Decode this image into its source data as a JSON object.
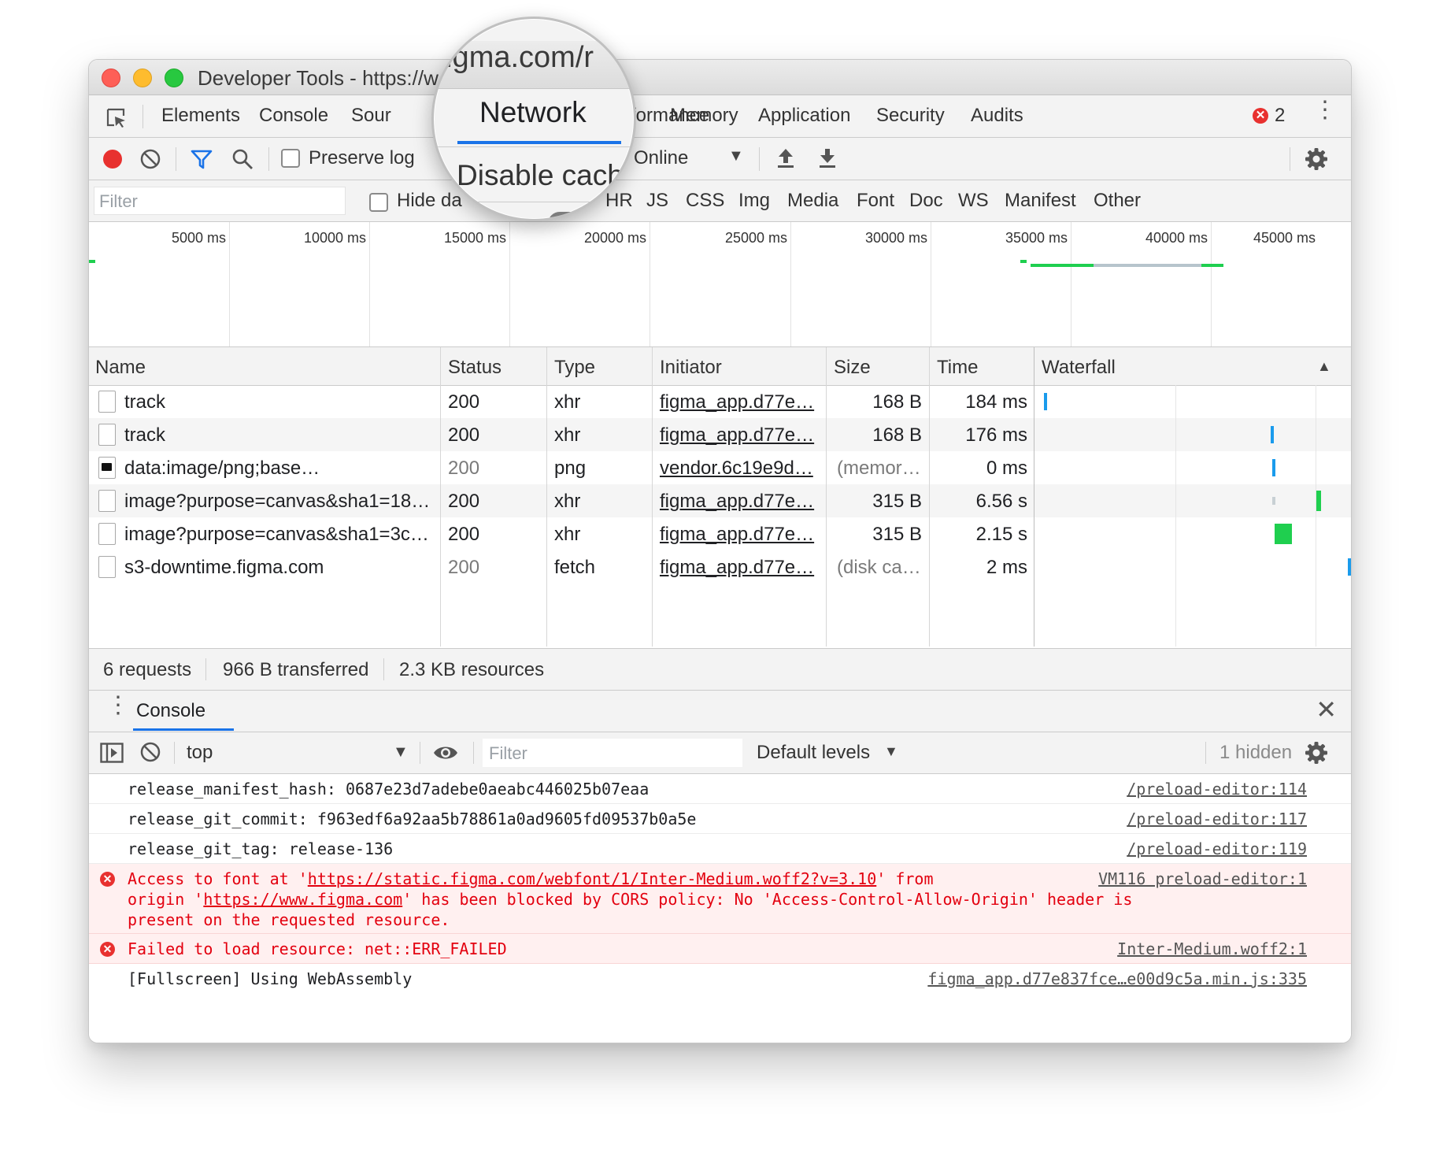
{
  "window": {
    "title": "Developer Tools - https://w"
  },
  "tabs": {
    "elements": "Elements",
    "console": "Console",
    "sources": "Sour",
    "network": "Network",
    "performance": "formance",
    "memory": "Memory",
    "application": "Application",
    "security": "Security",
    "audits": "Audits",
    "error_count": "2"
  },
  "toolbar": {
    "preserve_log": "Preserve log",
    "disable_cache": "Disable cache",
    "throttle": "Online"
  },
  "filterbar": {
    "placeholder": "Filter",
    "hide_data": "Hide da",
    "types": [
      "HR",
      "JS",
      "CSS",
      "Img",
      "Media",
      "Font",
      "Doc",
      "WS",
      "Manifest",
      "Other"
    ]
  },
  "overview": {
    "ticks": [
      "5000 ms",
      "10000 ms",
      "15000 ms",
      "20000 ms",
      "25000 ms",
      "30000 ms",
      "35000 ms",
      "40000 ms",
      "45000 ms"
    ]
  },
  "table": {
    "headers": {
      "name": "Name",
      "status": "Status",
      "type": "Type",
      "initiator": "Initiator",
      "size": "Size",
      "time": "Time",
      "waterfall": "Waterfall"
    },
    "rows": [
      {
        "name": "track",
        "status": "200",
        "type": "xhr",
        "initiator": "figma_app.d77e…",
        "size": "168 B",
        "time": "184 ms"
      },
      {
        "name": "track",
        "status": "200",
        "type": "xhr",
        "initiator": "figma_app.d77e…",
        "size": "168 B",
        "time": "176 ms"
      },
      {
        "name": "data:image/png;base…",
        "status": "200",
        "type": "png",
        "initiator": "vendor.6c19e9d…",
        "size": "(memor…",
        "time": "0 ms"
      },
      {
        "name": "image?purpose=canvas&sha1=18…",
        "status": "200",
        "type": "xhr",
        "initiator": "figma_app.d77e…",
        "size": "315 B",
        "time": "6.56 s"
      },
      {
        "name": "image?purpose=canvas&sha1=3c…",
        "status": "200",
        "type": "xhr",
        "initiator": "figma_app.d77e…",
        "size": "315 B",
        "time": "2.15 s"
      },
      {
        "name": "s3-downtime.figma.com",
        "status": "200",
        "type": "fetch",
        "initiator": "figma_app.d77e…",
        "size": "(disk ca…",
        "time": "2 ms"
      }
    ]
  },
  "summary": {
    "requests": "6 requests",
    "transferred": "966 B transferred",
    "resources": "2.3 KB resources"
  },
  "drawer": {
    "tab": "Console",
    "context": "top",
    "filter_placeholder": "Filter",
    "levels": "Default levels",
    "hidden": "1 hidden"
  },
  "console": {
    "msg1": {
      "text": "release_manifest_hash: 0687e23d7adebe0aeabc446025b07eaa",
      "source": "/preload-editor:114"
    },
    "msg2": {
      "text": "release_git_commit: f963edf6a92aa5b78861a0ad9605fd09537b0a5e",
      "source": "/preload-editor:117"
    },
    "msg3": {
      "text": "release_git_tag: release-136",
      "source": "/preload-editor:119"
    },
    "msg4": {
      "p1": "Access to font at '",
      "url1": "https://static.figma.com/webfont/1/Inter-Medium.woff2?v=3.10",
      "p2": "' from",
      "p3": "origin '",
      "url2": "https://www.figma.com",
      "p4": "' has been blocked by CORS policy: No 'Access-Control-Allow-Origin' header is",
      "p5": "present on the requested resource.",
      "source": "VM116 preload-editor:1"
    },
    "msg5": {
      "text": "Failed to load resource: net::ERR_FAILED",
      "source": "Inter-Medium.woff2:1"
    },
    "msg6": {
      "text": "[Fullscreen] Using WebAssembly",
      "source": "figma_app.d77e837fce…e00d9c5a.min.js:335"
    }
  },
  "magnifier": {
    "url": ".figma.com/r"
  },
  "colors": {
    "accent": "#1a73e8",
    "record": "#e8312f",
    "waterfall_blue": "#1a9bec",
    "waterfall_green": "#1fcf4f",
    "error_text": "#e3000f",
    "error_bg": "#fff0f0"
  }
}
